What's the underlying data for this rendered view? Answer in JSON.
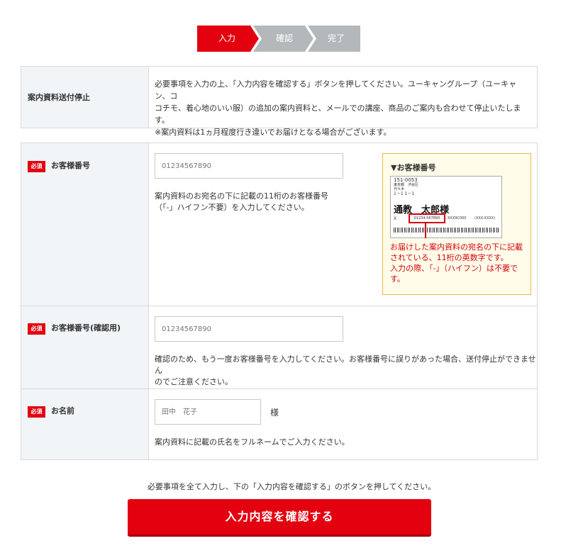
{
  "steps": [
    {
      "label": "入力"
    },
    {
      "label": "確認"
    },
    {
      "label": "完了"
    }
  ],
  "colors": {
    "accent": "#e3000f",
    "step_inactive": "#b4b8bb",
    "header_bg": "#f1f5f8",
    "example_border": "#e8b84b",
    "example_bg": "#fffde9"
  },
  "notice": {
    "heading": "案内資料送付停止",
    "line1": "必要事項を入力の上、「入力内容を確認する」ボタンを押してください。ユーキャングループ（ユーキャン、コ",
    "line2": "コチモ、着心地のいい服）の追加の案内資料と、メールでの講座、商品のご案内も合わせて停止いたします。",
    "line3": "※案内資料は1ヵ月程度行き違いでお届けとなる場合がございます。"
  },
  "required_label": "必須",
  "customer_number": {
    "label": "お客様番号",
    "placeholder": "01234567890",
    "help_line1": "案内資料のお宛名の下に記載の11桁のお客様番号",
    "help_line2": "（「-」ハイフン不要）を入力してください。"
  },
  "example": {
    "title": "▼お客様番号",
    "card": {
      "postal": "151-0053",
      "addr1": "東京都　渋谷区",
      "addr2": "代々木",
      "addr3": "1－1 1－1",
      "name": "通教　太郎様",
      "prefix": "X",
      "number": "01234-567890",
      "code1": "XXX9C000",
      "code2": "(XXX-XXXX)"
    },
    "note_line1": "お届けした案内資料の宛名の下に記載",
    "note_line2": "されている、11桁の英数字です。",
    "note_line3": "入力の際、「-」（ハイフン）は不要で",
    "note_line4": "す。"
  },
  "customer_number_confirm": {
    "label": "お客様番号(確認用)",
    "placeholder": "01234567890",
    "help_line1": "確認のため、もう一度お客様番号を入力してください。お客様番号に誤りがあった場合、送付停止ができません",
    "help_line2": "のでご注意ください。"
  },
  "name_field": {
    "label": "お名前",
    "placeholder": "田中　花子",
    "suffix": "様",
    "help": "案内資料に記載の氏名をフルネームでご入力ください。"
  },
  "bottom_note": "必要事項を全て入力し、下の「入力内容を確認する」のボタンを押してください。",
  "submit_label": "入力内容を確認する"
}
